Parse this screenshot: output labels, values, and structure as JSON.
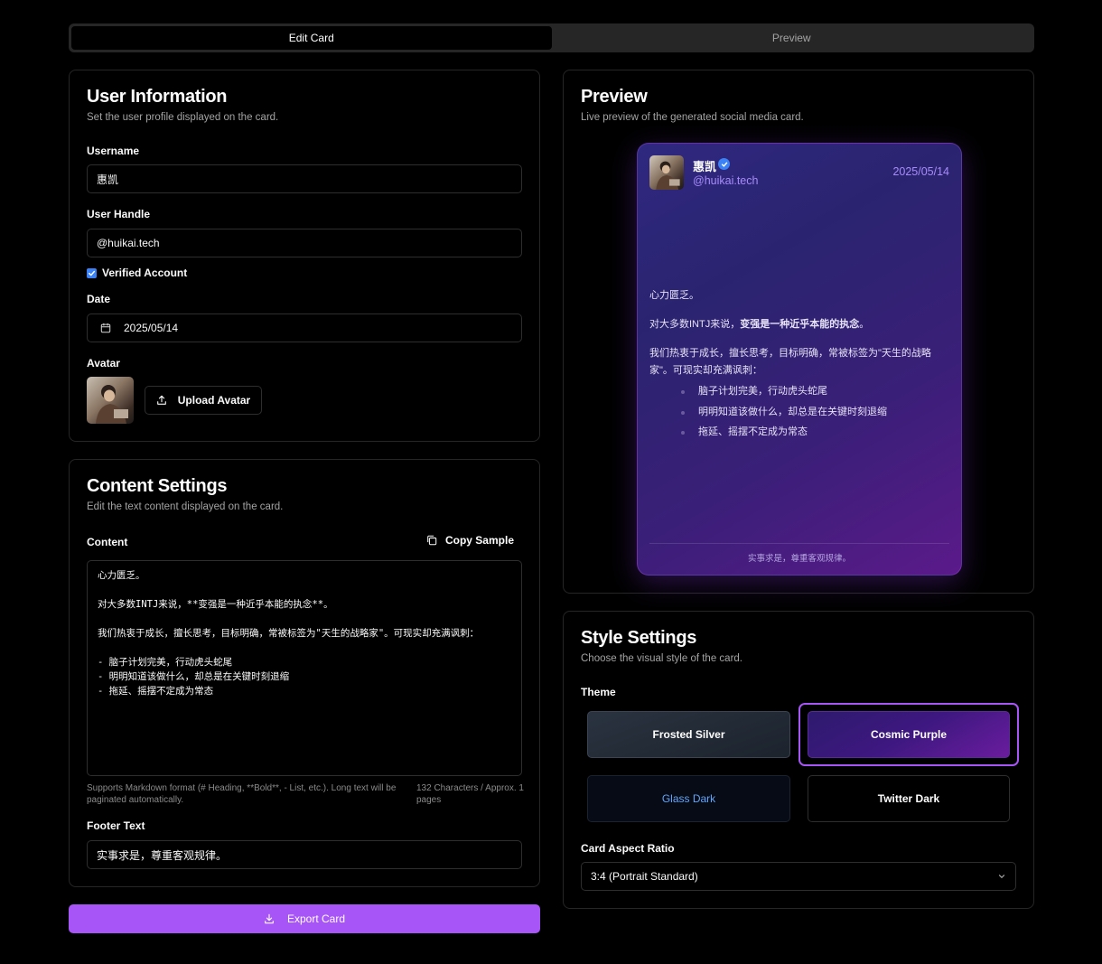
{
  "tabs": [
    {
      "label": "Edit Card",
      "active": true
    },
    {
      "label": "Preview",
      "active": false
    }
  ],
  "user_info": {
    "title": "User Information",
    "description": "Set the user profile displayed on the card.",
    "username_label": "Username",
    "username_value": "惠凯",
    "handle_label": "User Handle",
    "handle_value": "@huikai.tech",
    "verified_label": "Verified Account",
    "verified_checked": true,
    "date_label": "Date",
    "date_value": "2025/05/14",
    "avatar_label": "Avatar",
    "upload_label": "Upload Avatar"
  },
  "content_settings": {
    "title": "Content Settings",
    "description": "Edit the text content displayed on the card.",
    "content_label": "Content",
    "copy_sample_label": "Copy Sample",
    "content_value": "心力匮乏。\n\n对大多数INTJ来说，**变强是一种近乎本能的执念**。\n\n我们热衷于成长，擅长思考，目标明确，常被标签为\"天生的战略家\"。可现实却充满讽刺：\n\n- 脑子计划完美，行动虎头蛇尾\n- 明明知道该做什么，却总是在关键时刻退缩\n- 拖延、摇摆不定成为常态",
    "markdown_hint": "Supports Markdown format (# Heading, **Bold**, - List, etc.). Long text will be paginated automatically.",
    "char_count": "132 Characters / Approx. 1 pages",
    "footer_label": "Footer Text",
    "footer_value": "实事求是，尊重客观规律。"
  },
  "export_label": "Export Card",
  "preview": {
    "title": "Preview",
    "description": "Live preview of the generated social media card.",
    "card": {
      "name": "惠凯",
      "handle": "@huikai.tech",
      "date": "2025/05/14",
      "p1": "心力匮乏。",
      "p2_plain": "对大多数INTJ来说，",
      "p2_bold": "变强是一种近乎本能的执念",
      "p2_end": "。",
      "p3": "我们热衷于成长，擅长思考，目标明确，常被标签为\"天生的战略家\"。可现实却充满讽刺：",
      "bullets": [
        "脑子计划完美，行动虎头蛇尾",
        "明明知道该做什么，却总是在关键时刻退缩",
        "拖延、摇摆不定成为常态"
      ],
      "footer": "实事求是，尊重客观规律。"
    }
  },
  "style_settings": {
    "title": "Style Settings",
    "description": "Choose the visual style of the card.",
    "theme_label": "Theme",
    "themes": [
      "Frosted Silver",
      "Cosmic Purple",
      "Glass Dark",
      "Twitter Dark"
    ],
    "selected_theme": "Cosmic Purple",
    "aspect_label": "Card Aspect Ratio",
    "aspect_value": "3:4 (Portrait Standard)"
  },
  "colors": {
    "accent": "#a855f7",
    "verified": "#3b82f6",
    "handle": "#a78bfa"
  }
}
